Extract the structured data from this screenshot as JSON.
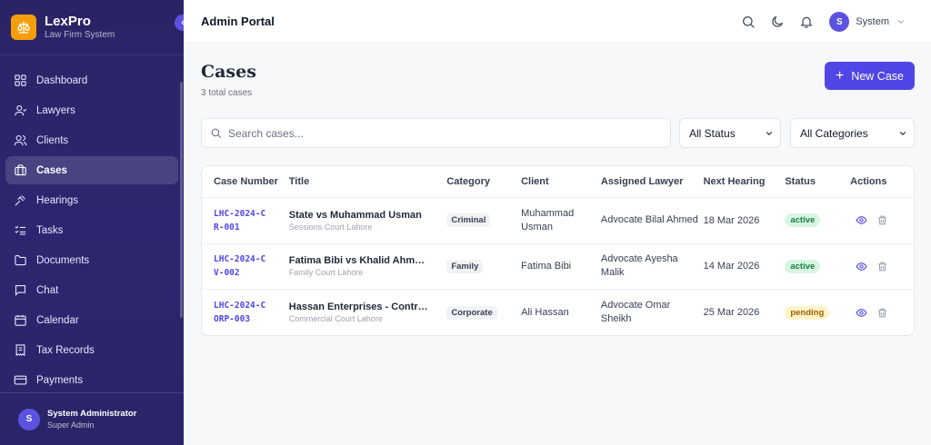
{
  "brand": {
    "name": "LexPro",
    "subtitle": "Law Firm System"
  },
  "sidebar": {
    "items": [
      {
        "label": "Dashboard",
        "icon": "grid-icon"
      },
      {
        "label": "Lawyers",
        "icon": "user-icon"
      },
      {
        "label": "Clients",
        "icon": "users-icon"
      },
      {
        "label": "Cases",
        "icon": "briefcase-icon",
        "active": true
      },
      {
        "label": "Hearings",
        "icon": "gavel-icon"
      },
      {
        "label": "Tasks",
        "icon": "checklist-icon"
      },
      {
        "label": "Documents",
        "icon": "folder-icon"
      },
      {
        "label": "Chat",
        "icon": "chat-icon"
      },
      {
        "label": "Calendar",
        "icon": "calendar-icon"
      },
      {
        "label": "Tax Records",
        "icon": "receipt-icon"
      },
      {
        "label": "Payments",
        "icon": "card-icon"
      }
    ],
    "user": {
      "initial": "S",
      "name": "System Administrator",
      "role": "Super Admin"
    }
  },
  "topbar": {
    "title": "Admin Portal",
    "user_initial": "S",
    "user_name": "System"
  },
  "page": {
    "title": "Cases",
    "subtitle": "3 total cases",
    "new_button": "New Case",
    "search_placeholder": "Search cases...",
    "status_filter": "All Status",
    "category_filter": "All Categories"
  },
  "table": {
    "headers": [
      "Case Number",
      "Title",
      "Category",
      "Client",
      "Assigned Lawyer",
      "Next Hearing",
      "Status",
      "Actions"
    ],
    "rows": [
      {
        "case_number": "LHC-2024-CR-001",
        "title": "State vs Muhammad Usman",
        "court": "Sessions Court Lahore",
        "category": "Criminal",
        "client": "Muhammad Usman",
        "lawyer": "Advocate Bilal Ahmed",
        "hearing": "18 Mar 2026",
        "status": "active"
      },
      {
        "case_number": "LHC-2024-CV-002",
        "title": "Fatima Bibi vs Khalid Ahmed ...",
        "court": "Family Court Lahore",
        "category": "Family",
        "client": "Fatima Bibi",
        "lawyer": "Advocate Ayesha Malik",
        "hearing": "14 Mar 2026",
        "status": "active"
      },
      {
        "case_number": "LHC-2024-CORP-003",
        "title": "Hassan Enterprises - Contra...",
        "court": "Commercial Court Lahore",
        "category": "Corporate",
        "client": "Ali Hassan",
        "lawyer": "Advocate Omar Sheikh",
        "hearing": "25 Mar 2026",
        "status": "pending"
      }
    ]
  },
  "colors": {
    "sidebar": "#2a2466",
    "accent": "#5046e5",
    "brand_logo": "#f59e0b",
    "active_badge": "#d8f5e4",
    "pending_badge": "#fdf3c8"
  }
}
